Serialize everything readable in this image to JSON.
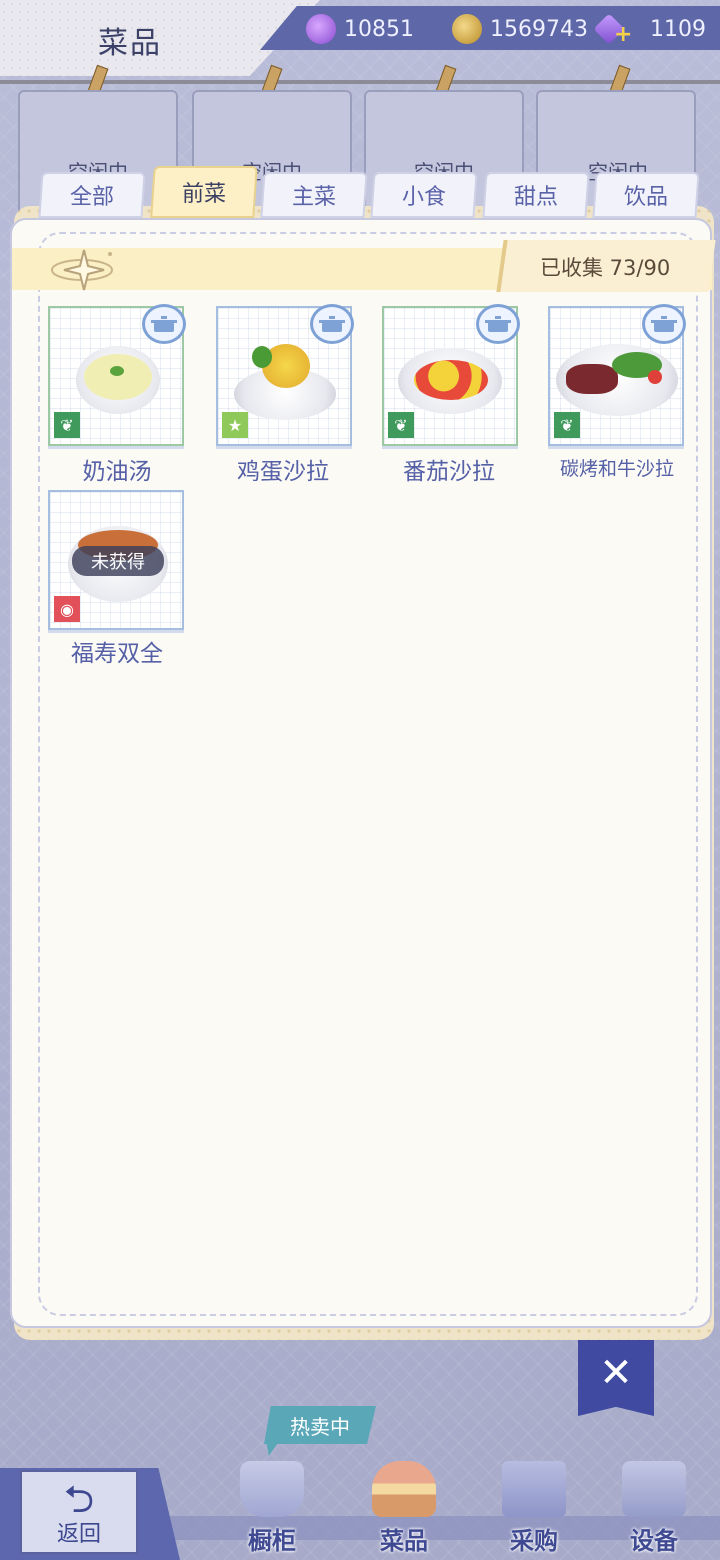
{
  "header": {
    "title": "菜品",
    "currencies": [
      {
        "icon": "purple-gem-icon",
        "value": "10851"
      },
      {
        "icon": "gold-coin-icon",
        "value": "1569743"
      },
      {
        "icon": "energy-plus-icon",
        "value": "1109"
      }
    ]
  },
  "idle_label": "空闲中",
  "tabs": [
    "全部",
    "前菜",
    "主菜",
    "小食",
    "甜点",
    "饮品"
  ],
  "active_tab": "前菜",
  "collection": {
    "label": "已收集 73/90"
  },
  "dishes": [
    {
      "name": "奶油汤",
      "badge": "leaf",
      "locked": false
    },
    {
      "name": "鸡蛋沙拉",
      "badge": "star",
      "locked": false
    },
    {
      "name": "番茄沙拉",
      "badge": "leaf",
      "locked": false
    },
    {
      "name": "碳烤和牛沙拉",
      "badge": "leaf",
      "locked": false
    },
    {
      "name": "福寿双全",
      "badge": "lantern",
      "locked": true,
      "locked_label": "未获得"
    }
  ],
  "close_label": "✕",
  "bottom_nav": {
    "hot_tag": "热卖中",
    "back": "返回",
    "items": [
      "橱柜",
      "菜品",
      "采购",
      "设备"
    ]
  },
  "colors": {
    "accent": "#5e67a8",
    "panel": "#fbfaf5",
    "active_tab": "#fdf0c6",
    "dish_name": "#5560a6"
  }
}
